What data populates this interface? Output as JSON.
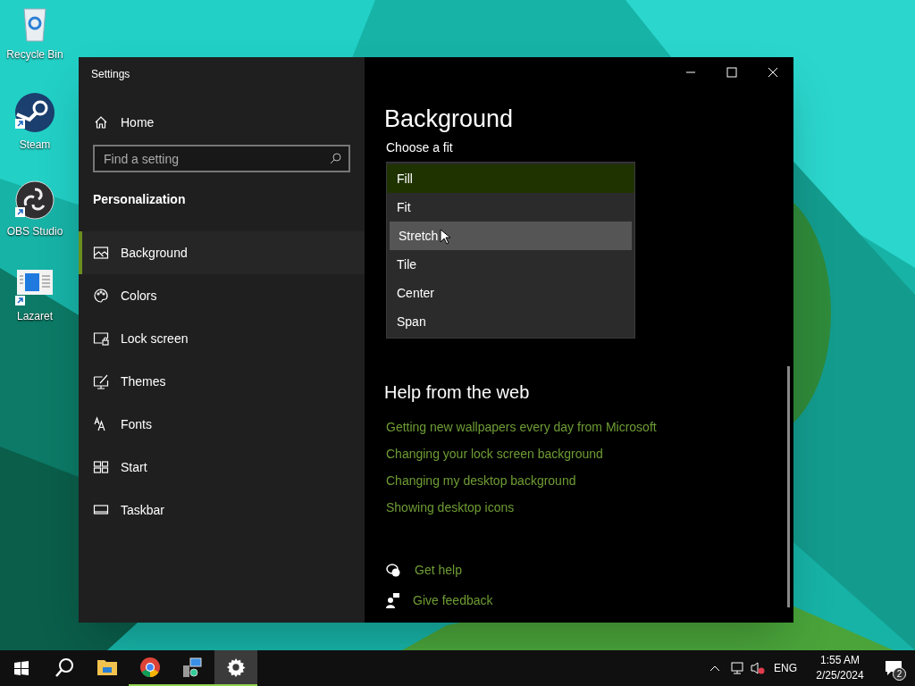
{
  "desktop_icons": [
    {
      "label": "Recycle Bin",
      "shortcut": false
    },
    {
      "label": "Steam",
      "shortcut": true
    },
    {
      "label": "OBS Studio",
      "shortcut": true
    },
    {
      "label": "Lazaret",
      "shortcut": true
    }
  ],
  "window": {
    "title": "Settings"
  },
  "sidebar": {
    "home": "Home",
    "search": {
      "placeholder": "Find a setting"
    },
    "section": "Personalization",
    "items": [
      {
        "label": "Background",
        "selected": true
      },
      {
        "label": "Colors",
        "selected": false
      },
      {
        "label": "Lock screen",
        "selected": false
      },
      {
        "label": "Themes",
        "selected": false
      },
      {
        "label": "Fonts",
        "selected": false
      },
      {
        "label": "Start",
        "selected": false
      },
      {
        "label": "Taskbar",
        "selected": false
      }
    ]
  },
  "content": {
    "title": "Background",
    "fit_label": "Choose a fit",
    "fit_options": [
      {
        "label": "Fill",
        "selected": true,
        "hovered": false
      },
      {
        "label": "Fit",
        "selected": false,
        "hovered": false
      },
      {
        "label": "Stretch",
        "selected": false,
        "hovered": true
      },
      {
        "label": "Tile",
        "selected": false,
        "hovered": false
      },
      {
        "label": "Center",
        "selected": false,
        "hovered": false
      },
      {
        "label": "Span",
        "selected": false,
        "hovered": false
      }
    ],
    "help_title": "Help from the web",
    "help_links": [
      "Getting new wallpapers every day from Microsoft",
      "Changing your lock screen background",
      "Changing my desktop background",
      "Showing desktop icons"
    ],
    "actions": [
      "Get help",
      "Give feedback"
    ]
  },
  "taskbar": {
    "apps": [
      {
        "kind": "search",
        "running": false,
        "active": false
      },
      {
        "kind": "folder",
        "running": false,
        "active": false
      },
      {
        "kind": "browser",
        "running": true,
        "active": false
      },
      {
        "kind": "installer",
        "running": true,
        "active": false
      },
      {
        "kind": "settings",
        "running": true,
        "active": true
      }
    ],
    "language": "ENG",
    "time": "1:55 AM",
    "date": "2/25/2024",
    "notifications": "2"
  }
}
